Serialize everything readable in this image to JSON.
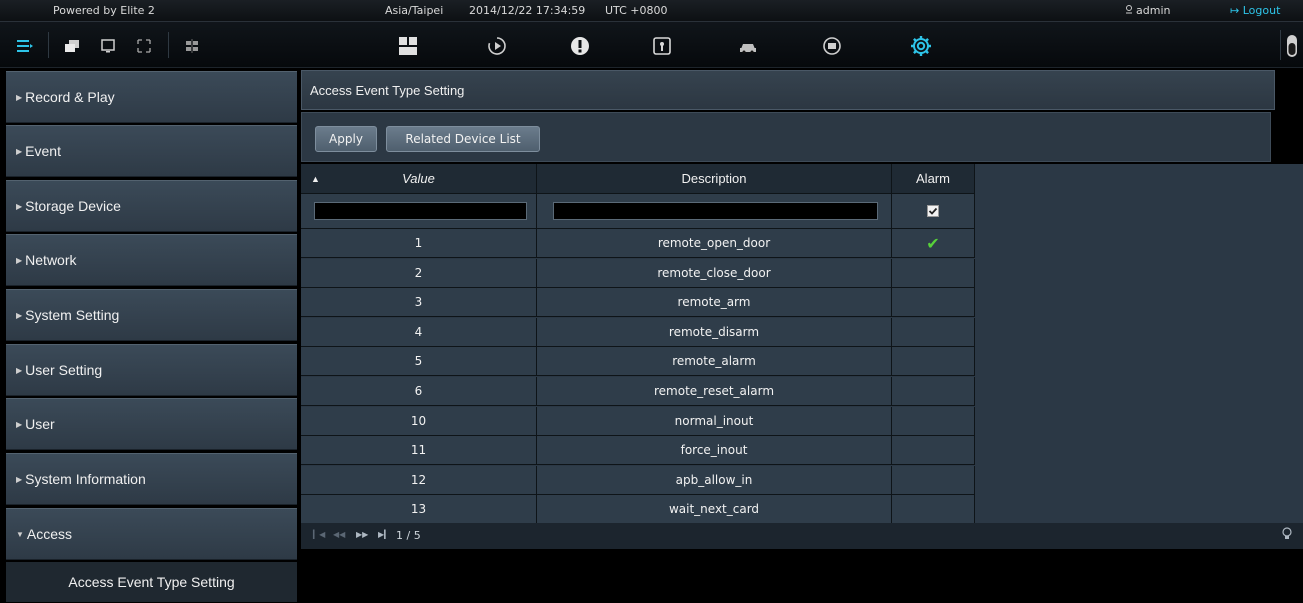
{
  "topbar": {
    "powered_by": "Powered by Elite 2",
    "timezone": "Asia/Taipei",
    "datetime": "2014/12/22 17:34:59",
    "utc": "UTC +0800",
    "user": "admin",
    "logout": "Logout"
  },
  "sidebar": {
    "items": [
      {
        "label": "Record & Play"
      },
      {
        "label": "Event"
      },
      {
        "label": "Storage Device"
      },
      {
        "label": "Network"
      },
      {
        "label": "System Setting"
      },
      {
        "label": "User Setting"
      },
      {
        "label": "User"
      },
      {
        "label": "System Information"
      },
      {
        "label": "Access"
      }
    ],
    "sub_item": "Access Event Type Setting"
  },
  "main": {
    "title": "Access Event Type Setting",
    "apply": "Apply",
    "related": "Related Device List"
  },
  "grid": {
    "headers": {
      "value": "Value",
      "description": "Description",
      "alarm": "Alarm"
    },
    "rows": [
      {
        "value": "1",
        "description": "remote_open_door",
        "alarm": true
      },
      {
        "value": "2",
        "description": "remote_close_door",
        "alarm": false
      },
      {
        "value": "3",
        "description": "remote_arm",
        "alarm": false
      },
      {
        "value": "4",
        "description": "remote_disarm",
        "alarm": false
      },
      {
        "value": "5",
        "description": "remote_alarm",
        "alarm": false
      },
      {
        "value": "6",
        "description": "remote_reset_alarm",
        "alarm": false
      },
      {
        "value": "10",
        "description": "normal_inout",
        "alarm": false
      },
      {
        "value": "11",
        "description": "force_inout",
        "alarm": false
      },
      {
        "value": "12",
        "description": "apb_allow_in",
        "alarm": false
      },
      {
        "value": "13",
        "description": "wait_next_card",
        "alarm": false
      }
    ],
    "page": "1 / 5"
  },
  "colors": {
    "accent": "#2ec4e8",
    "check": "#57d13a"
  }
}
